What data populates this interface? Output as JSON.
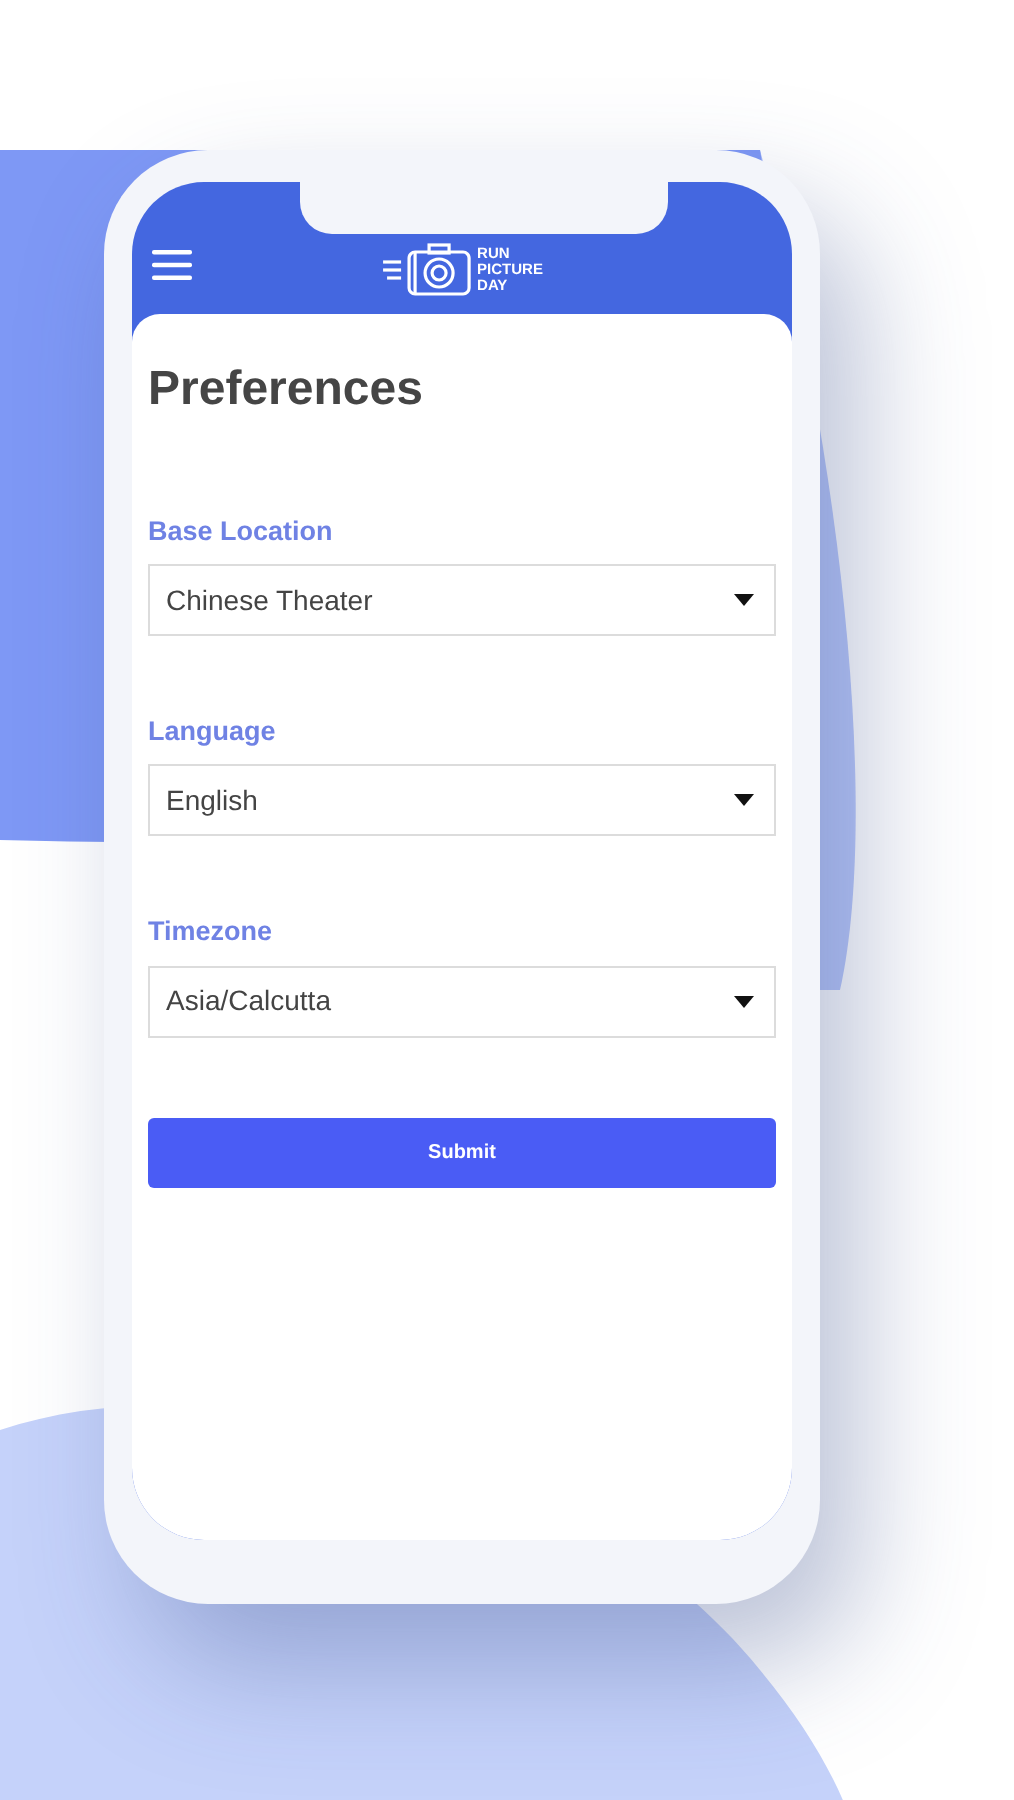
{
  "header": {
    "logo_lines": [
      "RUN",
      "PICTURE",
      "DAY"
    ]
  },
  "title": "Preferences",
  "fields": [
    {
      "label": "Base Location",
      "value": "Chinese Theater"
    },
    {
      "label": "Language",
      "value": "English"
    },
    {
      "label": "Timezone",
      "value": "Asia/Calcutta"
    }
  ],
  "submit_button": "Submit"
}
